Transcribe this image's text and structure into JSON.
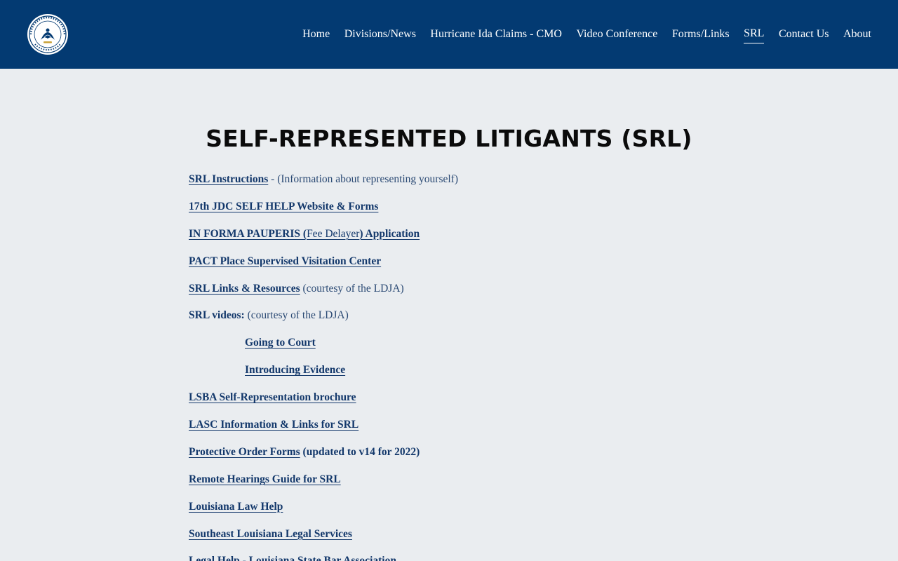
{
  "header": {
    "nav": [
      {
        "label": "Home",
        "active": false
      },
      {
        "label": "Divisions/News",
        "active": false
      },
      {
        "label": "Hurricane Ida Claims - CMO",
        "active": false
      },
      {
        "label": "Video Conference",
        "active": false
      },
      {
        "label": "Forms/Links",
        "active": false
      },
      {
        "label": "SRL",
        "active": true
      },
      {
        "label": "Contact Us",
        "active": false
      },
      {
        "label": "About",
        "active": false
      }
    ],
    "logo_icon": "state-seal-icon",
    "bg_color": "#033a72"
  },
  "main": {
    "title": "SELF-REPRESENTED LITIGANTS (SRL)",
    "items": [
      {
        "link": "SRL Instructions",
        "note": " - (Information about representing yourself)"
      },
      {
        "link": "17th JDC SELF HELP Website & Forms"
      },
      {
        "link_a": "IN FORMA PAUPERIS (",
        "link_b": "Fee Delayer",
        "link_c": ") Application"
      },
      {
        "link": "PACT Place Supervised Visitation Center"
      },
      {
        "link": "SRL Links & Resources",
        "note": " (courtesy of the LDJA)"
      },
      {
        "label": "SRL videos:",
        "note": " (courtesy of the LDJA)"
      },
      {
        "link": "Going to Court"
      },
      {
        "link": "Introducing Evidence"
      },
      {
        "link": "LSBA Self-Representation brochure"
      },
      {
        "link": "LASC Information & Links for SRL"
      },
      {
        "link": "Protective Order Forms",
        "bold_note": " (updated to v14 for 2022)"
      },
      {
        "link": "Remote Hearings Guide for SRL"
      },
      {
        "link": "Louisiana Law Help"
      },
      {
        "link": "Southeast Louisiana Legal Services"
      },
      {
        "link": "Legal Help - Louisiana State Bar Association"
      }
    ]
  },
  "colors": {
    "page_bg": "#eaedf0",
    "link": "#13386b",
    "title": "#0b0b0b"
  }
}
